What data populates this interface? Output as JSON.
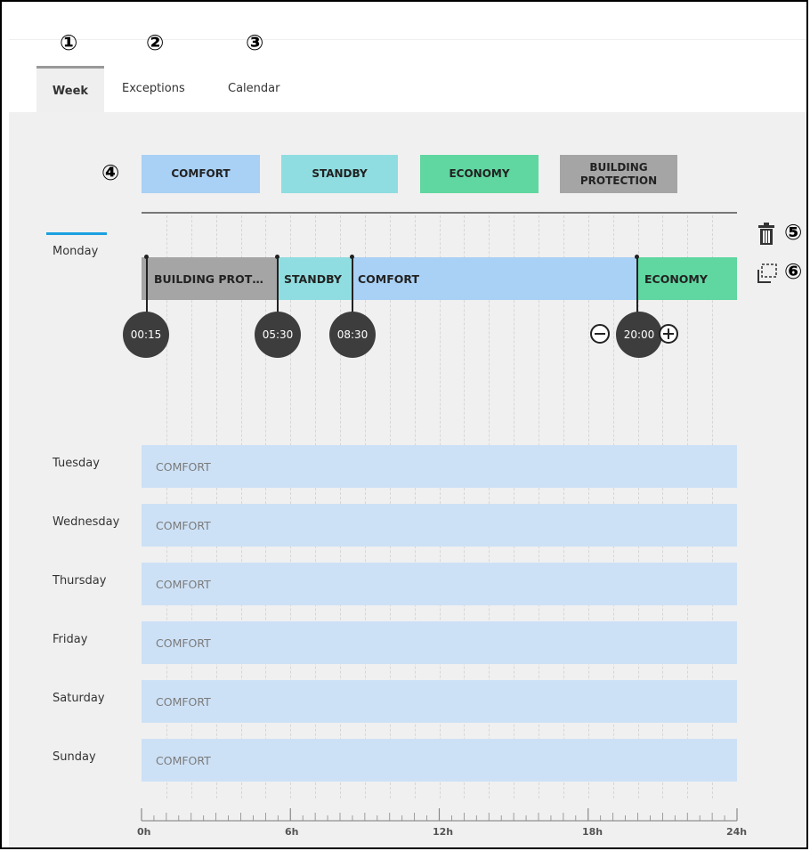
{
  "callouts": [
    "①",
    "②",
    "③",
    "④",
    "⑤",
    "⑥"
  ],
  "tabs": [
    {
      "label": "Week",
      "active": true
    },
    {
      "label": "Exceptions",
      "active": false
    },
    {
      "label": "Calendar",
      "active": false
    }
  ],
  "legend": [
    {
      "label": "COMFORT",
      "color": "#a9d0f5"
    },
    {
      "label": "STANDBY",
      "color": "#8fdde0"
    },
    {
      "label": "ECONOMY",
      "color": "#60d6a0"
    },
    {
      "label": "BUILDING PROTECTION",
      "color": "#a5a5a5"
    }
  ],
  "icons": {
    "delete": "trash-icon",
    "copy": "copy-icon"
  },
  "monday": {
    "label": "Monday",
    "segments": [
      {
        "label": "BUILDING PROT…",
        "mode": "building-protection",
        "start": "00:15",
        "end": "05:30"
      },
      {
        "label": "STANDBY",
        "mode": "standby",
        "start": "05:30",
        "end": "08:30"
      },
      {
        "label": "COMFORT",
        "mode": "comfort",
        "start": "08:30",
        "end": "20:00"
      },
      {
        "label": "ECONOMY",
        "mode": "economy",
        "start": "20:00",
        "end": "24:00"
      }
    ],
    "switch_times": [
      "00:15",
      "05:30",
      "08:30",
      "20:00"
    ],
    "selected_switch": "20:00"
  },
  "days": [
    {
      "label": "Tuesday",
      "mode": "COMFORT"
    },
    {
      "label": "Wednesday",
      "mode": "COMFORT"
    },
    {
      "label": "Thursday",
      "mode": "COMFORT"
    },
    {
      "label": "Friday",
      "mode": "COMFORT"
    },
    {
      "label": "Saturday",
      "mode": "COMFORT"
    },
    {
      "label": "Sunday",
      "mode": "COMFORT"
    }
  ],
  "axis": {
    "labels": [
      "0h",
      "6h",
      "12h",
      "18h",
      "24h"
    ],
    "unit": "hours",
    "range": [
      0,
      24
    ]
  }
}
